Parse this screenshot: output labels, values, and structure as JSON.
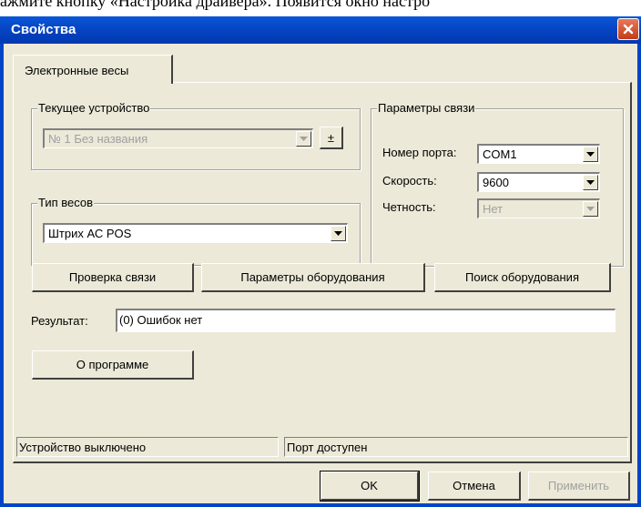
{
  "background_text": "ажмите кнопку «Настройка драйвера». Появится окно настро",
  "window": {
    "title": "Свойства",
    "close_icon": "close-icon"
  },
  "tabs": [
    {
      "label": "Электронные весы"
    }
  ],
  "current_device": {
    "legend": "Текущее устройство",
    "value": "№ 1 Без названия",
    "plusminus_label": "±"
  },
  "scale_type": {
    "legend": "Тип весов",
    "value": "Штрих АС POS"
  },
  "connection": {
    "legend": "Параметры связи",
    "port_label": "Номер порта:",
    "port_value": "COM1",
    "speed_label": "Скорость:",
    "speed_value": "9600",
    "parity_label": "Четность:",
    "parity_value": "Нет"
  },
  "buttons": {
    "check_connection": "Проверка связи",
    "equipment_params": "Параметры оборудования",
    "search_equipment": "Поиск оборудования",
    "about": "О программе"
  },
  "result": {
    "label": "Результат:",
    "value": "(0) Ошибок нет"
  },
  "status": {
    "device": "Устройство выключено",
    "port": "Порт доступен"
  },
  "dialog_buttons": {
    "ok": "OK",
    "cancel": "Отмена",
    "apply": "Применить"
  },
  "colors": {
    "titlebar": "#0645c3",
    "close": "#c23c18",
    "face": "#ece9d8"
  }
}
